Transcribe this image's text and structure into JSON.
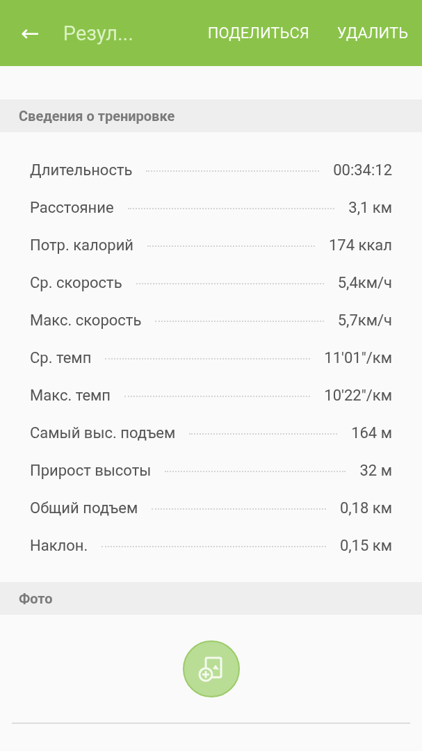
{
  "app_bar": {
    "back": "←",
    "title": "Резул...",
    "actions": [
      "ПОДЕЛИТЬСЯ",
      "УДАЛИТЬ"
    ]
  },
  "workout_section": {
    "title": "Сведения о тренировке",
    "rows": [
      {
        "label": "Длительность",
        "value": "00:34:12"
      },
      {
        "label": "Расстояние",
        "value": "3,1 км"
      },
      {
        "label": "Потр. калорий",
        "value": "174 ккал"
      },
      {
        "label": "Ср. скорость",
        "value": "5,4км/ч"
      },
      {
        "label": "Макс. скорость",
        "value": "5,7км/ч"
      },
      {
        "label": "Ср. темп",
        "value": "11'01\"/км"
      },
      {
        "label": "Макс. темп",
        "value": "10'22\"/км"
      },
      {
        "label": "Самый выс. подъем",
        "value": "164 м"
      },
      {
        "label": "Прирост высоты",
        "value": "32 м"
      },
      {
        "label": "Общий подъем",
        "value": "0,18 км"
      },
      {
        "label": "Наклон.",
        "value": "0,15 км"
      }
    ]
  },
  "photo_section": {
    "title": "Фото"
  }
}
